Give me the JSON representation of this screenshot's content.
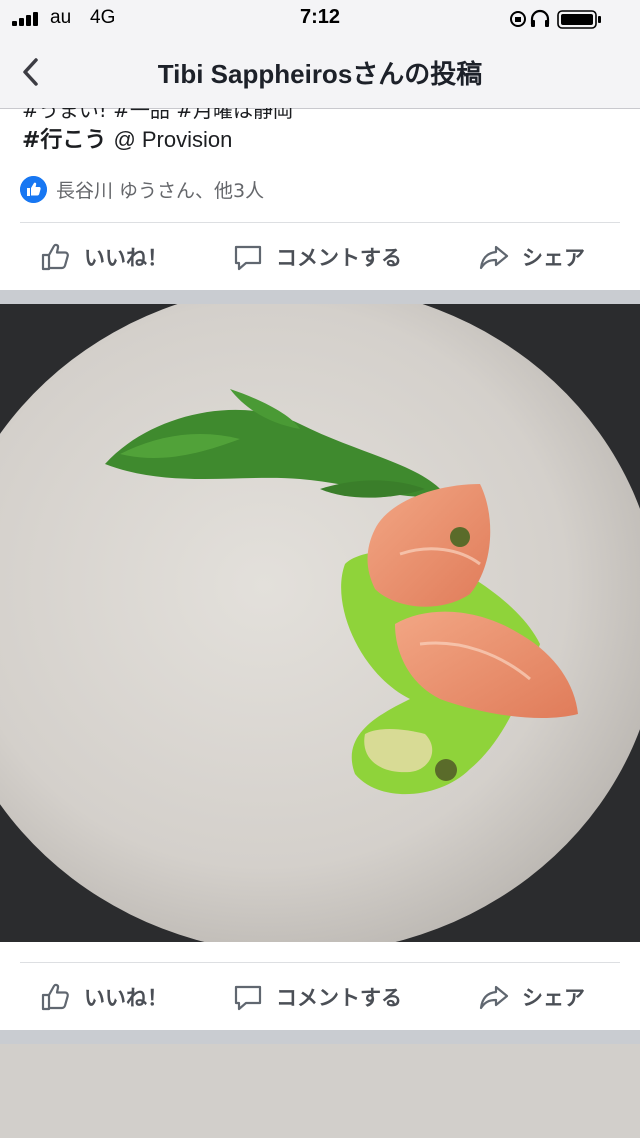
{
  "status_bar": {
    "carrier": "au",
    "network": "4G",
    "time": "7:12"
  },
  "nav": {
    "title": "Tibi Sappheirosさんの投稿"
  },
  "post": {
    "cut_line": "#うまい! #一品 #月曜は静岡",
    "hashtag": "#行こう",
    "location": "@ Provision",
    "reactions_text": "長谷川 ゆうさん、他3人"
  },
  "actions": {
    "like": "いいね！",
    "comment": "コメントする",
    "share": "シェア"
  },
  "colors": {
    "accent": "#1877f2",
    "divider": "#dddfe2",
    "section_gap": "#c9ccd1"
  },
  "icons": [
    "back-chevron-icon",
    "thumbs-up-icon",
    "comment-bubble-icon",
    "share-arrow-icon",
    "like-badge-icon"
  ]
}
